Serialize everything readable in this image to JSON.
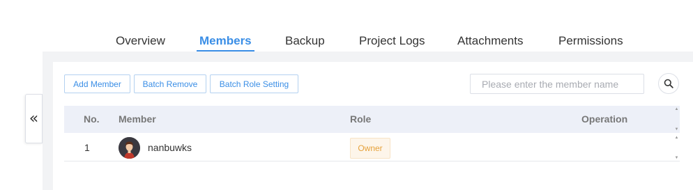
{
  "tabs": [
    {
      "label": "Overview"
    },
    {
      "label": "Members"
    },
    {
      "label": "Backup"
    },
    {
      "label": "Project Logs"
    },
    {
      "label": "Attachments"
    },
    {
      "label": "Permissions"
    }
  ],
  "active_tab": "Members",
  "collapse_glyph": "«",
  "toolbar": {
    "add_member": "Add Member",
    "batch_remove": "Batch Remove",
    "batch_role_setting": "Batch Role Setting"
  },
  "search": {
    "placeholder": "Please enter the member name",
    "value": ""
  },
  "table": {
    "headers": {
      "no": "No.",
      "member": "Member",
      "role": "Role",
      "operation": "Operation"
    },
    "rows": [
      {
        "no": "1",
        "member": "nanbuwks",
        "role": "Owner"
      }
    ]
  },
  "colors": {
    "accent": "#3a8ee6",
    "role_owner_text": "#e6a23c",
    "role_owner_bg": "#fdf5ea",
    "table_header_bg": "#edf0f8"
  },
  "icons": {
    "collapse": "double-chevron-left-icon",
    "search": "search-icon",
    "avatar": "user-avatar-icon"
  }
}
